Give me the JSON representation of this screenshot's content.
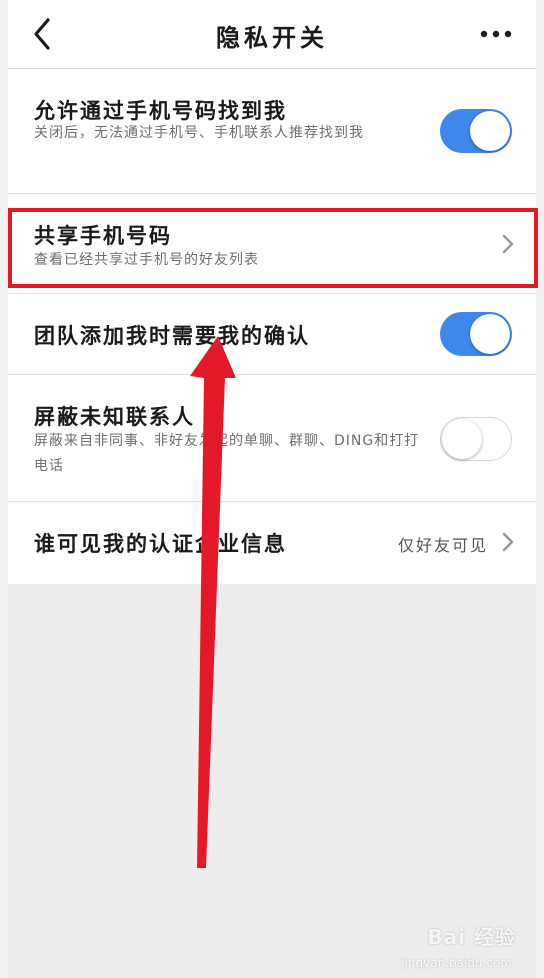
{
  "header": {
    "title": "隐私开关",
    "back_icon": "chevron-left-icon",
    "more_icon": "more-icon"
  },
  "settings": [
    {
      "title": "允许通过手机号码找到我",
      "desc": "关闭后，无法通过手机号、手机联系人推荐找到我",
      "toggle": "on"
    },
    {
      "title": "共享手机号码",
      "desc": "查看已经共享过手机号的好友列表",
      "chevron": true
    },
    {
      "title": "团队添加我时需要我的确认",
      "toggle": "on"
    },
    {
      "title": "屏蔽未知联系人",
      "desc": "屏蔽来自非同事、非好友发起的单聊、群聊、DING和打打电话",
      "toggle": "off"
    },
    {
      "title": "谁可见我的认证企业信息",
      "value": "仅好友可见",
      "chevron": true
    }
  ],
  "watermark": {
    "brand": "Bai 经验",
    "url": "jingyan.baidu.com"
  },
  "colors": {
    "toggle_on": "#3d88ea",
    "highlight": "#e3192a",
    "arrow": "#e3192a"
  }
}
